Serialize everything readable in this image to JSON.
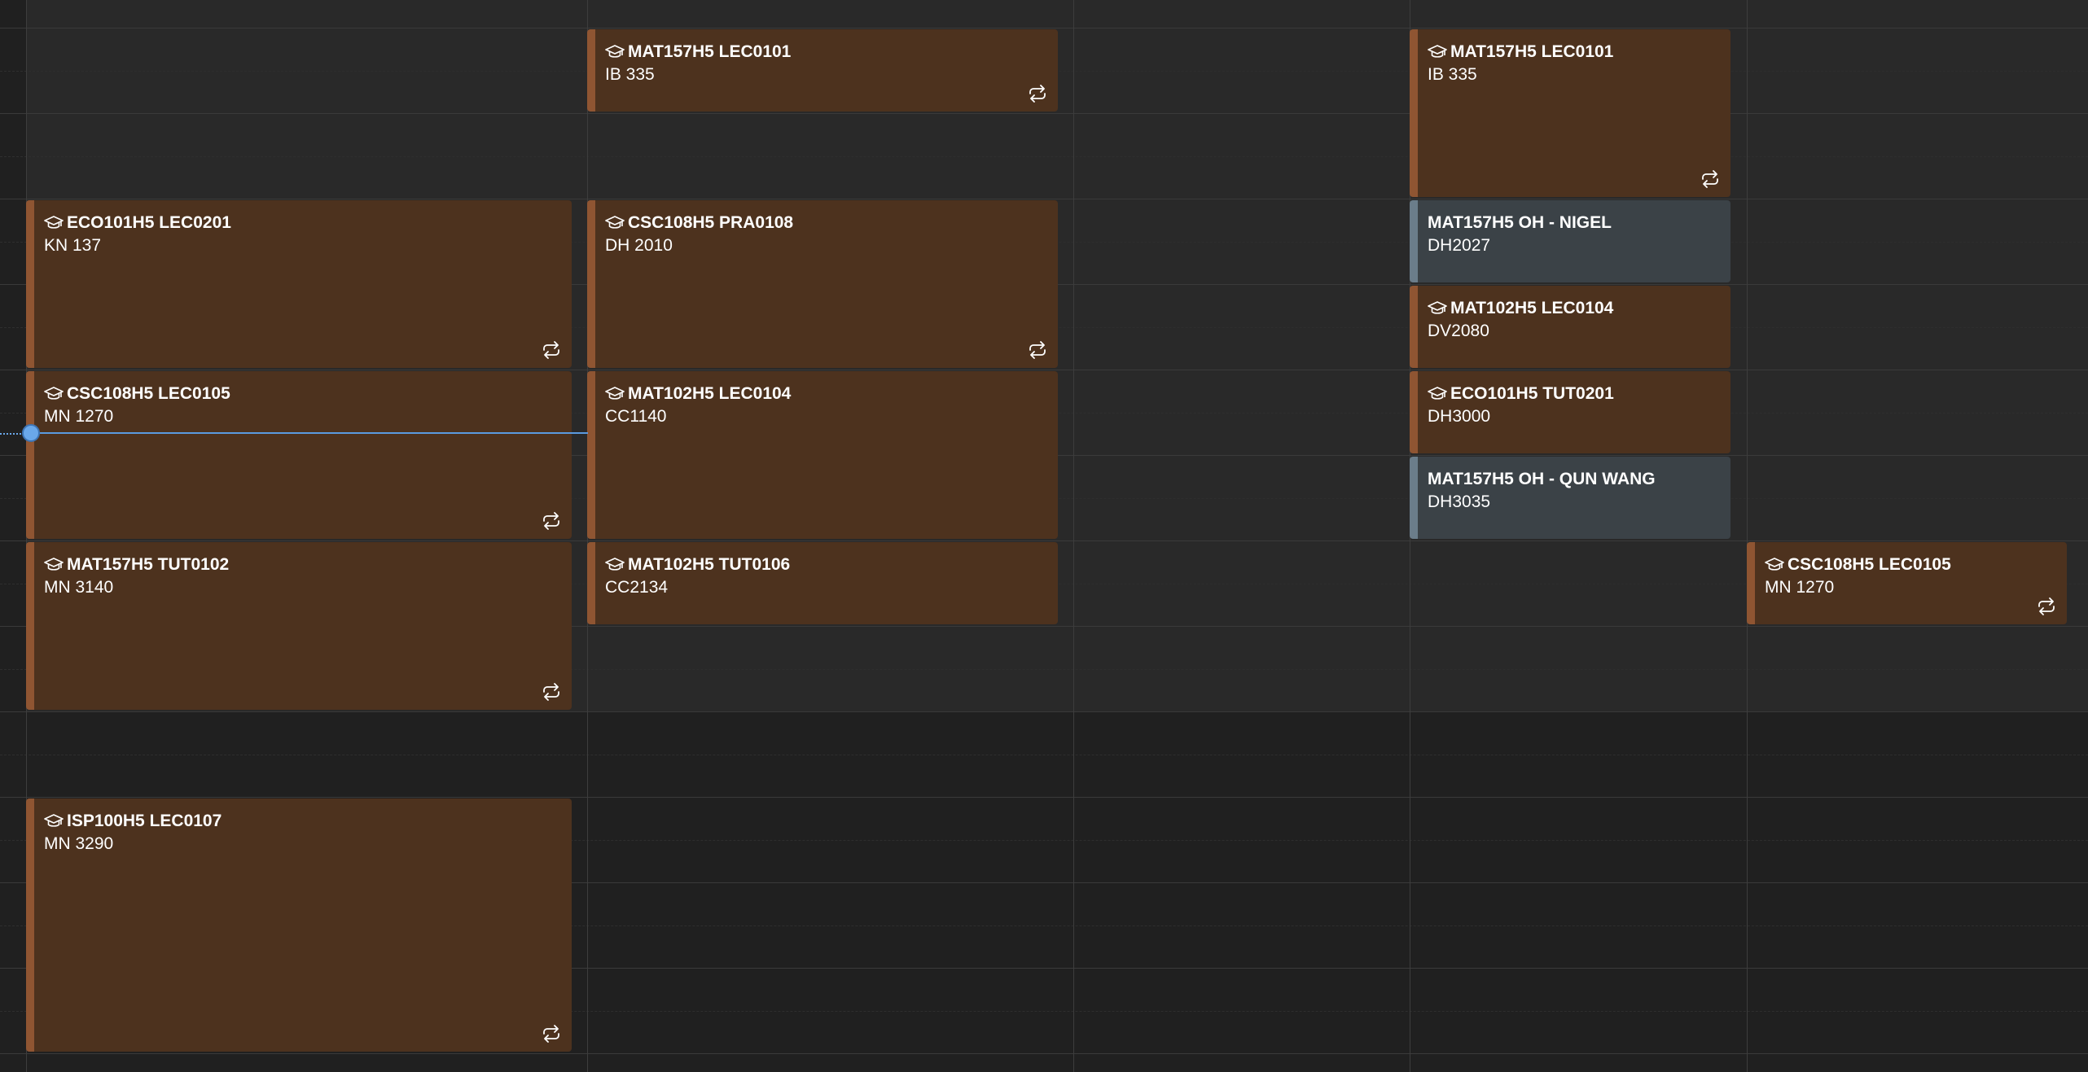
{
  "events": [
    {
      "title": "MAT157H5 LEC0101",
      "location": "IB 335",
      "kind": "class",
      "recurring": true
    },
    {
      "title": "MAT157H5 LEC0101",
      "location": "IB 335",
      "kind": "class",
      "recurring": true
    },
    {
      "title": "ECO101H5 LEC0201",
      "location": "KN 137",
      "kind": "class",
      "recurring": true
    },
    {
      "title": "CSC108H5 PRA0108",
      "location": "DH 2010",
      "kind": "class",
      "recurring": true
    },
    {
      "title": "MAT157H5 OH - NIGEL",
      "location": "DH2027",
      "kind": "office-hours",
      "recurring": false
    },
    {
      "title": "MAT102H5 LEC0104",
      "location": "DV2080",
      "kind": "class",
      "recurring": false
    },
    {
      "title": "CSC108H5 LEC0105",
      "location": "MN 1270",
      "kind": "class",
      "recurring": true
    },
    {
      "title": "MAT102H5 LEC0104",
      "location": "CC1140",
      "kind": "class",
      "recurring": false
    },
    {
      "title": "ECO101H5 TUT0201",
      "location": "DH3000",
      "kind": "class",
      "recurring": false
    },
    {
      "title": "MAT157H5 OH - QUN WANG",
      "location": "DH3035",
      "kind": "office-hours",
      "recurring": false
    },
    {
      "title": "MAT157H5 TUT0102",
      "location": "MN 3140",
      "kind": "class",
      "recurring": true
    },
    {
      "title": "MAT102H5 TUT0106",
      "location": "CC2134",
      "kind": "class",
      "recurring": false
    },
    {
      "title": "CSC108H5 LEC0105",
      "location": "MN 1270",
      "kind": "class",
      "recurring": true
    },
    {
      "title": "ISP100H5 LEC0107",
      "location": "MN 3290",
      "kind": "class",
      "recurring": true
    }
  ],
  "icons": {
    "class": "graduation-cap-icon",
    "recurring": "repeat-icon"
  },
  "colors": {
    "background": "#202020",
    "class_fill": "#4d321e",
    "class_accent": "#8f5532",
    "office_hours_fill": "#3b4247",
    "office_hours_accent": "#6b7d8a",
    "now_indicator": "#6aa8ea"
  }
}
